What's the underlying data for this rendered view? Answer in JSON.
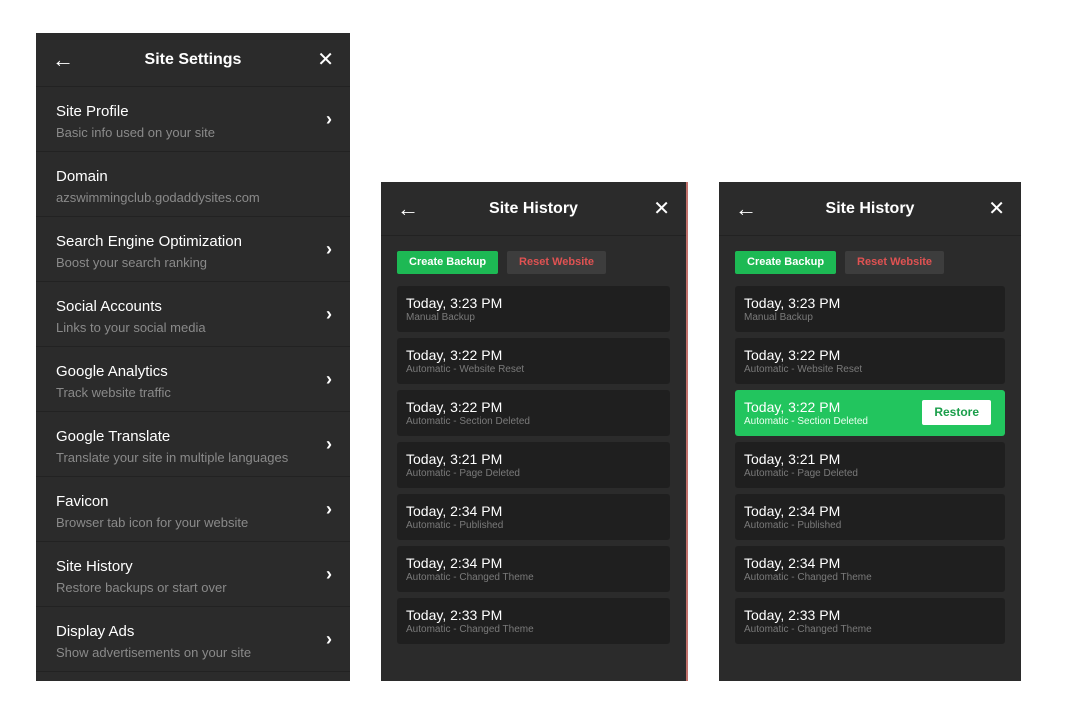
{
  "settings": {
    "title": "Site Settings",
    "items": [
      {
        "title": "Site Profile",
        "subtitle": "Basic info used on your site",
        "chevron": true
      },
      {
        "title": "Domain",
        "subtitle": "azswimmingclub.godaddysites.com",
        "chevron": false
      },
      {
        "title": "Search Engine Optimization",
        "subtitle": "Boost your search ranking",
        "chevron": true
      },
      {
        "title": "Social Accounts",
        "subtitle": "Links to your social media",
        "chevron": true
      },
      {
        "title": "Google Analytics",
        "subtitle": "Track website traffic",
        "chevron": true
      },
      {
        "title": "Google Translate",
        "subtitle": "Translate your site in multiple languages",
        "chevron": true
      },
      {
        "title": "Favicon",
        "subtitle": "Browser tab icon for your website",
        "chevron": true
      },
      {
        "title": "Site History",
        "subtitle": "Restore backups or start over",
        "chevron": true
      },
      {
        "title": "Display Ads",
        "subtitle": "Show advertisements on your site",
        "chevron": true
      }
    ]
  },
  "history": {
    "title": "Site History",
    "create_label": "Create Backup",
    "reset_label": "Reset Website",
    "restore_label": "Restore",
    "entries": [
      {
        "time": "Today, 3:23 PM",
        "desc": "Manual Backup"
      },
      {
        "time": "Today, 3:22 PM",
        "desc": "Automatic - Website Reset"
      },
      {
        "time": "Today, 3:22 PM",
        "desc": "Automatic - Section Deleted"
      },
      {
        "time": "Today, 3:21 PM",
        "desc": "Automatic - Page Deleted"
      },
      {
        "time": "Today, 2:34 PM",
        "desc": "Automatic - Published"
      },
      {
        "time": "Today, 2:34 PM",
        "desc": "Automatic - Changed Theme"
      },
      {
        "time": "Today, 2:33 PM",
        "desc": "Automatic - Changed Theme"
      }
    ]
  },
  "icons": {
    "back": "back-arrow-icon",
    "close": "close-icon",
    "chevron": "chevron-right-icon"
  },
  "colors": {
    "panel": "#2b2b2b",
    "accent_green": "#22c55e",
    "reset_text": "#e05252"
  }
}
